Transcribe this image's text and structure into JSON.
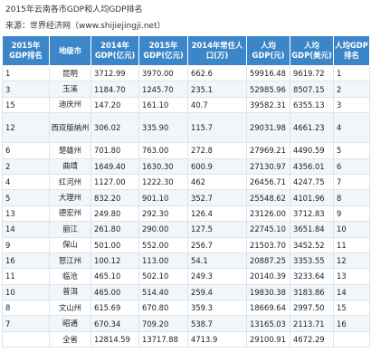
{
  "title": "2015年云南各市GDP和人均GDP排名",
  "source": "来源：世界经济网（www.shijiejingji.net）",
  "table": {
    "headers": [
      "2015年GDP排名",
      "地级市",
      "2014年GDP(亿元)",
      "2015年GDP(亿元)",
      "2014年常住人口(万)",
      "人均GDP(元)",
      "人均GDP(美元)",
      "人均GDP排名"
    ],
    "rows": [
      [
        "1",
        "昆明",
        "3712.99",
        "3970.00",
        "662.6",
        "59916.48",
        "9619.72",
        "1"
      ],
      [
        "3",
        "玉溪",
        "1184.70",
        "1245.70",
        "235.1",
        "52985.96",
        "8507.15",
        "2"
      ],
      [
        "15",
        "迪庆州",
        "147.20",
        "161.10",
        "40.7",
        "39582.31",
        "6355.13",
        "3"
      ],
      [
        "12",
        "西双版纳州",
        "306.02",
        "335.90",
        "115.7",
        "29031.98",
        "4661.23",
        "4"
      ],
      [
        "6",
        "楚雄州",
        "701.80",
        "763.00",
        "272.8",
        "27969.21",
        "4490.59",
        "5"
      ],
      [
        "2",
        "曲靖",
        "1649.40",
        "1630.30",
        "600.9",
        "27130.97",
        "4356.01",
        "6"
      ],
      [
        "4",
        "红河州",
        "1127.00",
        "1222.30",
        "462",
        "26456.71",
        "4247.75",
        "7"
      ],
      [
        "5",
        "大理州",
        "832.20",
        "901.10",
        "352.7",
        "25548.62",
        "4101.96",
        "8"
      ],
      [
        "13",
        "德宏州",
        "249.80",
        "292.30",
        "126.4",
        "23126.00",
        "3712.83",
        "9"
      ],
      [
        "14",
        "丽江",
        "261.80",
        "290.00",
        "127.5",
        "22745.10",
        "3651.84",
        "10"
      ],
      [
        "9",
        "保山",
        "501.00",
        "552.00",
        "256.7",
        "21503.70",
        "3452.52",
        "11"
      ],
      [
        "16",
        "怒江州",
        "100.12",
        "113.00",
        "54.1",
        "20887.25",
        "3353.55",
        "12"
      ],
      [
        "11",
        "临沧",
        "465.10",
        "502.10",
        "249.3",
        "20140.39",
        "3233.64",
        "13"
      ],
      [
        "10",
        "普洱",
        "465.00",
        "514.40",
        "259.4",
        "19830.38",
        "3183.86",
        "14"
      ],
      [
        "8",
        "文山州",
        "615.69",
        "670.80",
        "359.3",
        "18669.64",
        "2997.50",
        "15"
      ],
      [
        "7",
        "昭通",
        "670.34",
        "709.20",
        "538.7",
        "13165.03",
        "2113.71",
        "16"
      ],
      [
        "",
        "全省",
        "12814.59",
        "13717.88",
        "4713.9",
        "29100.91",
        "4672.29",
        ""
      ]
    ]
  }
}
